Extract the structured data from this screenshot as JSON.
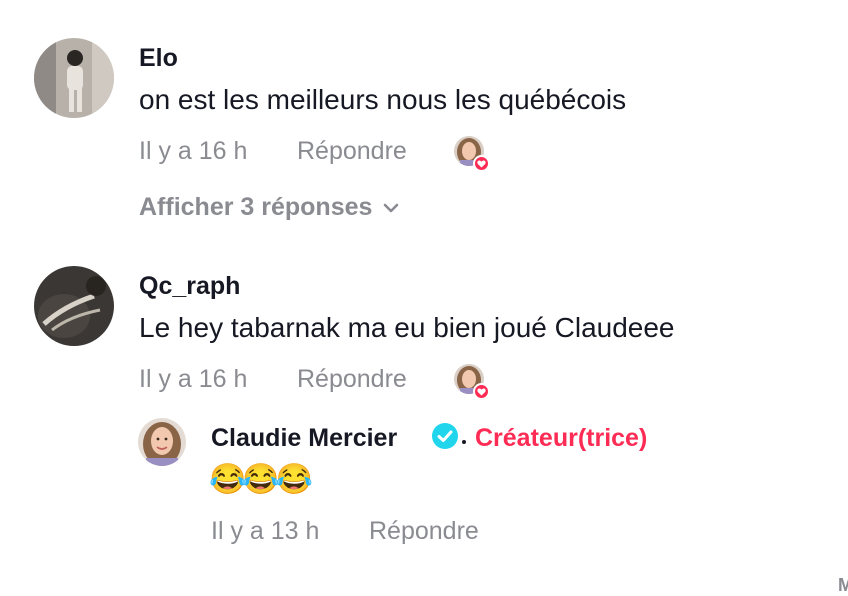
{
  "comments": [
    {
      "username": "Elo",
      "text": "on est les meilleurs nous les québécois",
      "time": "Il y a 16 h",
      "reply_label": "Répondre",
      "view_replies": "Afficher 3 réponses"
    },
    {
      "username": "Qc_raph",
      "text": "Le hey tabarnak ma eu bien joué Claudeee",
      "time": "Il y a 16 h",
      "reply_label": "Répondre",
      "replies": [
        {
          "username": "Claudie Mercier",
          "creator_label": "Créateur(trice)",
          "text": "😂😂😂",
          "time": "Il y a 13 h",
          "reply_label": "Répondre"
        }
      ]
    }
  ],
  "corner_glyph": "M",
  "colors": {
    "accent": "#fe2c55",
    "verified": "#20d5ec",
    "meta": "#8a8b91",
    "text": "#161823"
  },
  "icons": [
    "creator-liked-heart-icon",
    "chevron-down-icon",
    "verified-badge-icon"
  ]
}
